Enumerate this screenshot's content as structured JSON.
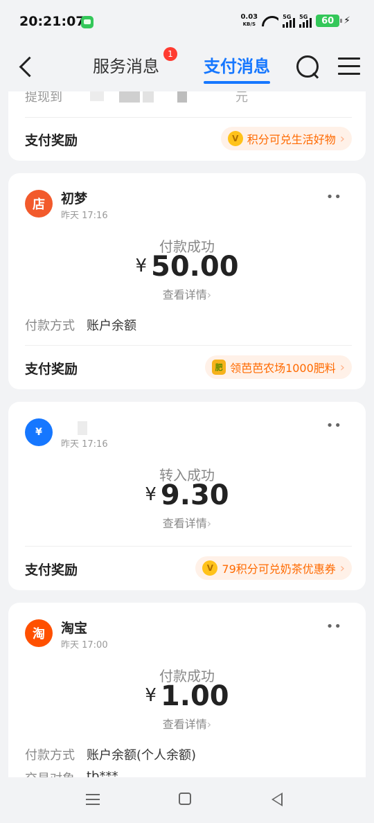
{
  "status_bar": {
    "time": "20:21:07",
    "net_speed": "0.03",
    "net_unit": "KB/S",
    "sim1": "5G",
    "sim2": "5G",
    "battery": "60"
  },
  "nav": {
    "tab_service": "服务消息",
    "service_badge": "1",
    "tab_pay": "支付消息"
  },
  "cards": [
    {
      "partial_label": "提现到",
      "partial_suffix": "元",
      "reward_label": "支付奖励",
      "reward_text": "积分可兑生活好物"
    },
    {
      "avatar_glyph": "店",
      "name": "初梦",
      "time": "昨天 17:16",
      "status": "付款成功",
      "currency": "¥",
      "amount": "50.00",
      "detail": "查看详情",
      "method_label": "付款方式",
      "method_value": "账户余额",
      "reward_label": "支付奖励",
      "reward_icon_glyph": "肥",
      "reward_text": "领芭芭农场1000肥料"
    },
    {
      "avatar_glyph": "¥",
      "name": "",
      "time": "昨天 17:16",
      "status": "转入成功",
      "currency": "¥",
      "amount": "9.30",
      "detail": "查看详情",
      "reward_label": "支付奖励",
      "reward_text": "79积分可兑奶茶优惠券"
    },
    {
      "avatar_glyph": "淘",
      "name": "淘宝",
      "time": "昨天 17:00",
      "status": "付款成功",
      "currency": "¥",
      "amount": "1.00",
      "detail": "查看详情",
      "method_label": "付款方式",
      "method_value": "账户余额(个人余额)",
      "counterparty_label": "交易对象",
      "counterparty_value": "tb***"
    }
  ],
  "icons": {
    "more": "••",
    "chevron": "›",
    "coin": "V"
  },
  "colors": {
    "accent": "#1677ff",
    "reward": "#ff6a00",
    "shop_avatar": "#f25a2c",
    "transfer_avatar": "#1677ff",
    "taobao_avatar": "#ff5000"
  }
}
